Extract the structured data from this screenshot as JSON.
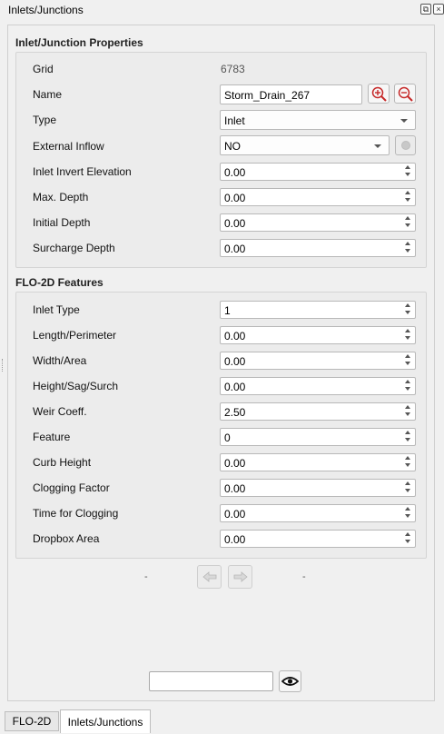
{
  "dock": {
    "title": "Inlets/Junctions"
  },
  "properties": {
    "heading": "Inlet/Junction Properties",
    "grid_label": "Grid",
    "grid_value": "6783",
    "name_label": "Name",
    "name_value": "Storm_Drain_267",
    "type_label": "Type",
    "type_value": "Inlet",
    "external_inflow_label": "External Inflow",
    "external_inflow_value": "NO",
    "invert_label": "Inlet Invert Elevation",
    "invert_value": "0.00",
    "max_depth_label": "Max. Depth",
    "max_depth_value": "0.00",
    "initial_depth_label": "Initial Depth",
    "initial_depth_value": "0.00",
    "surcharge_label": "Surcharge Depth",
    "surcharge_value": "0.00"
  },
  "flo2d": {
    "heading": "FLO-2D Features",
    "inlet_type_label": "Inlet Type",
    "inlet_type_value": "1",
    "length_label": "Length/Perimeter",
    "length_value": "0.00",
    "width_label": "Width/Area",
    "width_value": "0.00",
    "height_label": "Height/Sag/Surch",
    "height_value": "0.00",
    "weir_label": "Weir Coeff.",
    "weir_value": "2.50",
    "feature_label": "Feature",
    "feature_value": "0",
    "curb_label": "Curb Height",
    "curb_value": "0.00",
    "clogging_label": "Clogging Factor",
    "clogging_value": "0.00",
    "time_clogging_label": "Time for Clogging",
    "time_clogging_value": "0.00",
    "dropbox_label": "Dropbox Area",
    "dropbox_value": "0.00"
  },
  "navigation": {
    "left_text": "-",
    "right_text": "-",
    "prev_icon": "arrow-left-icon",
    "next_icon": "arrow-right-icon"
  },
  "bottom": {
    "search_value": "",
    "eye_icon": "eye-icon"
  },
  "tabs": [
    {
      "label": "FLO-2D"
    },
    {
      "label": "Inlets/Junctions"
    }
  ],
  "colors": {
    "zoom_icon": "#c62828"
  }
}
